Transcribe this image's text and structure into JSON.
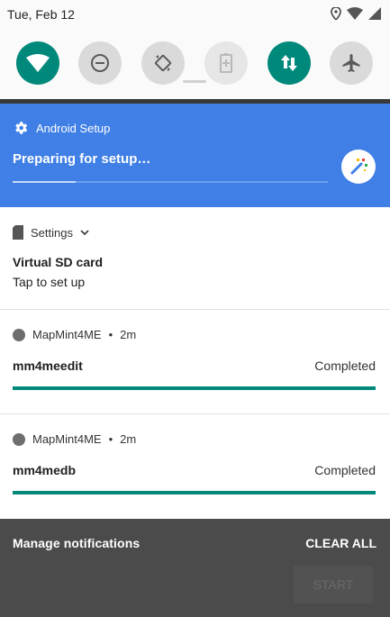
{
  "status_bar": {
    "date": "Tue, Feb 12",
    "icons": [
      "location-icon",
      "wifi-signal-icon",
      "cell-signal-icon"
    ]
  },
  "quick_settings": [
    {
      "name": "wifi-tile",
      "icon": "wifi-icon",
      "state": "on"
    },
    {
      "name": "do-not-disturb-tile",
      "icon": "dnd-icon",
      "state": "off"
    },
    {
      "name": "auto-rotate-tile",
      "icon": "rotate-icon",
      "state": "off"
    },
    {
      "name": "battery-saver-tile",
      "icon": "battery-icon",
      "state": "disabled"
    },
    {
      "name": "mobile-data-tile",
      "icon": "data-arrows-icon",
      "state": "on"
    },
    {
      "name": "airplane-mode-tile",
      "icon": "airplane-icon",
      "state": "off"
    }
  ],
  "setup_notification": {
    "app": "Android Setup",
    "title": "Preparing for setup…",
    "color": "#3f7fe6"
  },
  "sd_notification": {
    "app": "Settings",
    "title": "Virtual SD card",
    "text": "Tap to set up"
  },
  "downloads": [
    {
      "app": "MapMint4ME",
      "time": "2m",
      "title": "mm4meedit",
      "status": "Completed",
      "progress": 1.0
    },
    {
      "app": "MapMint4ME",
      "time": "2m",
      "title": "mm4medb",
      "status": "Completed",
      "progress": 1.0
    }
  ],
  "footer": {
    "manage": "Manage notifications",
    "clear_all": "CLEAR ALL",
    "start": "START"
  },
  "colors": {
    "accent": "#00897b",
    "setup_bg": "#3f7fe6"
  }
}
